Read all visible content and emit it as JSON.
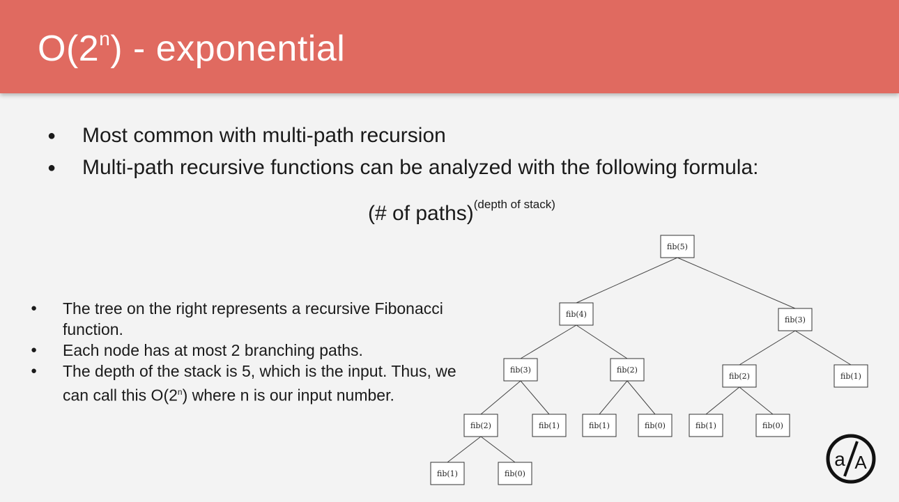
{
  "slide": {
    "title": {
      "base": "O(2",
      "sup": "n",
      "rest": ") - exponential"
    },
    "top_bullets": [
      "Most common with multi-path recursion",
      "Multi-path recursive functions can be analyzed with the following formula:"
    ],
    "formula": {
      "base": "(# of paths)",
      "sup": "(depth of stack)"
    },
    "bottom_bullets": {
      "b1": "The tree on the right represents a recursive Fibonacci function.",
      "b2": "Each node has at most 2 branching paths.",
      "b3_pre": "The depth of the stack is 5, which is the input. Thus, we can call this O(2",
      "b3_sup": "n",
      "b3_post": ") where n is our input number."
    }
  },
  "tree": {
    "nodes": [
      {
        "id": "n0",
        "label": "fib(5)"
      },
      {
        "id": "n1",
        "label": "fib(4)"
      },
      {
        "id": "n2",
        "label": "fib(3)"
      },
      {
        "id": "n3",
        "label": "fib(3)"
      },
      {
        "id": "n4",
        "label": "fib(2)"
      },
      {
        "id": "n5",
        "label": "fib(2)"
      },
      {
        "id": "n6",
        "label": "fib(1)"
      },
      {
        "id": "n7",
        "label": "fib(2)"
      },
      {
        "id": "n8",
        "label": "fib(1)"
      },
      {
        "id": "n9",
        "label": "fib(1)"
      },
      {
        "id": "n10",
        "label": "fib(0)"
      },
      {
        "id": "n11",
        "label": "fib(1)"
      },
      {
        "id": "n12",
        "label": "fib(0)"
      },
      {
        "id": "n13",
        "label": "fib(1)"
      },
      {
        "id": "n14",
        "label": "fib(0)"
      }
    ],
    "edges": [
      [
        "n0",
        "n1"
      ],
      [
        "n0",
        "n2"
      ],
      [
        "n1",
        "n3"
      ],
      [
        "n1",
        "n4"
      ],
      [
        "n2",
        "n5"
      ],
      [
        "n2",
        "n6"
      ],
      [
        "n3",
        "n7"
      ],
      [
        "n3",
        "n8"
      ],
      [
        "n4",
        "n9"
      ],
      [
        "n4",
        "n10"
      ],
      [
        "n5",
        "n11"
      ],
      [
        "n5",
        "n12"
      ],
      [
        "n7",
        "n13"
      ],
      [
        "n7",
        "n14"
      ]
    ]
  },
  "logo": {
    "icon": "app-academy-logo-icon",
    "text": "a/A"
  }
}
